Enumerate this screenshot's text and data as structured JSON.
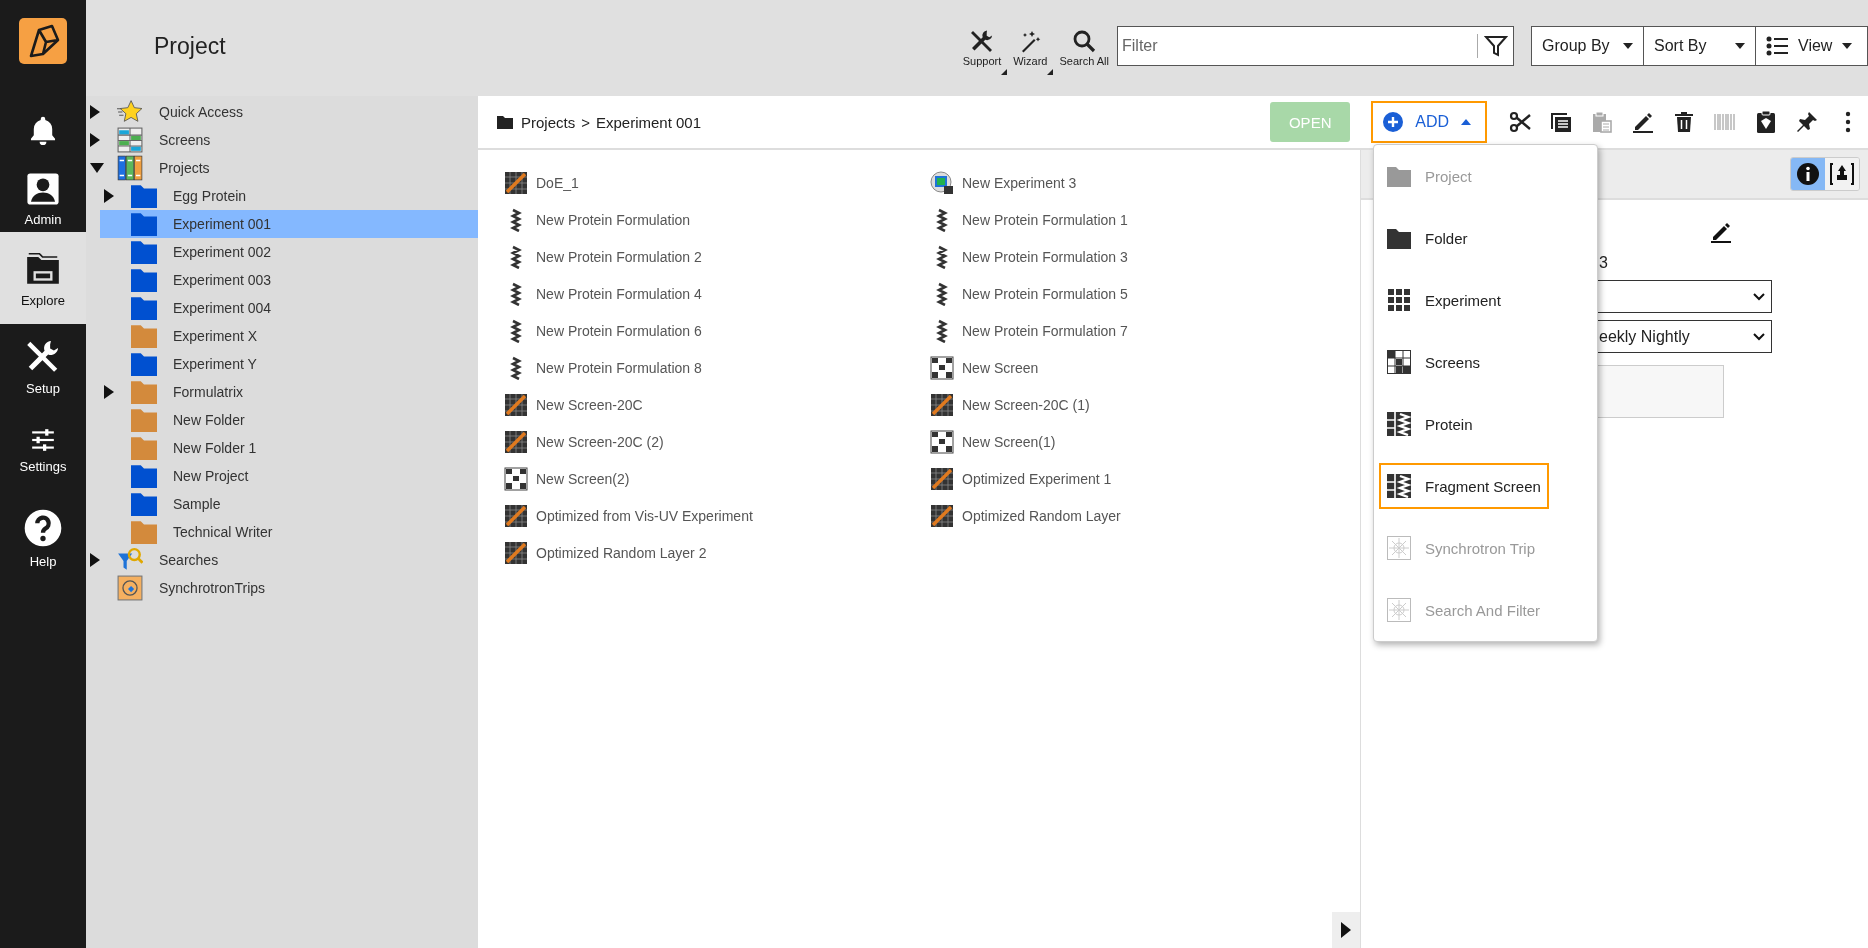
{
  "sidebar": {
    "items": [
      {
        "kind": "bell",
        "selected": false
      },
      {
        "kind": "user",
        "label": "Admin",
        "selected": false
      },
      {
        "kind": "explore",
        "label": "Explore",
        "selected": true
      },
      {
        "kind": "setup",
        "label": "Setup",
        "selected": false
      },
      {
        "kind": "settings",
        "label": "Settings",
        "selected": false
      },
      {
        "kind": "help",
        "label": "Help",
        "selected": false
      }
    ]
  },
  "header": {
    "title": "Project",
    "tools": [
      {
        "kind": "support",
        "label": "Support",
        "has_menu": true
      },
      {
        "kind": "wizard",
        "label": "Wizard",
        "has_menu": true
      },
      {
        "kind": "search",
        "label": "Search All",
        "has_menu": false
      }
    ],
    "filter": {
      "placeholder": "Filter"
    },
    "dropdowns": [
      {
        "kind": "plain",
        "label": "Group By"
      },
      {
        "kind": "plain",
        "label": "Sort By"
      },
      {
        "kind": "view",
        "label": "View"
      }
    ]
  },
  "tree": [
    {
      "label": "Quick Access",
      "kind": "star",
      "expanded": false,
      "selected": false
    },
    {
      "label": "Screens",
      "kind": "screens",
      "expanded": false,
      "selected": false
    },
    {
      "label": "Projects",
      "kind": "binder",
      "expanded": true,
      "selected": false,
      "children": [
        {
          "label": "Egg Protein",
          "kind": "folder",
          "color": "#0050d0",
          "expanded": false,
          "selected": false
        },
        {
          "label": "Experiment 001",
          "kind": "folder",
          "color": "#0050d0",
          "selected": true
        },
        {
          "label": "Experiment 002",
          "kind": "folder",
          "color": "#0050d0",
          "selected": false
        },
        {
          "label": "Experiment 003",
          "kind": "folder",
          "color": "#0050d0",
          "selected": false
        },
        {
          "label": "Experiment 004",
          "kind": "folder",
          "color": "#0050d0",
          "selected": false
        },
        {
          "label": "Experiment X",
          "kind": "folder",
          "color": "#d38a3c",
          "selected": false
        },
        {
          "label": "Experiment Y",
          "kind": "folder",
          "color": "#0050d0",
          "selected": false
        },
        {
          "label": "Formulatrix",
          "kind": "folder",
          "color": "#d38a3c",
          "expanded": false,
          "selected": false
        },
        {
          "label": "New Folder",
          "kind": "folder",
          "color": "#d38a3c",
          "selected": false
        },
        {
          "label": "New Folder 1",
          "kind": "folder",
          "color": "#d38a3c",
          "selected": false
        },
        {
          "label": "New Project",
          "kind": "folder",
          "color": "#0050d0",
          "selected": false
        },
        {
          "label": "Sample",
          "kind": "folder",
          "color": "#0050d0",
          "selected": false
        },
        {
          "label": "Technical Writer",
          "kind": "folder",
          "color": "#d38a3c",
          "selected": false
        }
      ]
    },
    {
      "label": "Searches",
      "kind": "searches",
      "expanded": false,
      "selected": false
    },
    {
      "label": "SynchrotronTrips",
      "kind": "synchrotron",
      "selected": false
    }
  ],
  "breadcrumb": {
    "items": [
      "Projects",
      "Experiment 001"
    ],
    "separator": ">"
  },
  "actions": {
    "open": {
      "label": "OPEN",
      "disabled": true
    },
    "add": {
      "label": "ADD",
      "expanded": true
    },
    "tools": [
      {
        "kind": "cut",
        "disabled": false
      },
      {
        "kind": "copy",
        "disabled": false
      },
      {
        "kind": "paste",
        "disabled": true
      },
      {
        "kind": "edit",
        "disabled": false
      },
      {
        "kind": "delete",
        "disabled": false
      },
      {
        "kind": "barcode",
        "disabled": true
      },
      {
        "kind": "clipboard",
        "disabled": false
      },
      {
        "kind": "pin",
        "disabled": false
      },
      {
        "kind": "more",
        "disabled": false
      }
    ]
  },
  "files": [
    {
      "name": "DoE_1",
      "kind": "optimization"
    },
    {
      "name": "New Experiment 3",
      "kind": "experiment"
    },
    {
      "name": "New Protein Formulation",
      "kind": "protein"
    },
    {
      "name": "New Protein Formulation 1",
      "kind": "protein"
    },
    {
      "name": "New Protein Formulation 2",
      "kind": "protein"
    },
    {
      "name": "New Protein Formulation 3",
      "kind": "protein"
    },
    {
      "name": "New Protein Formulation 4",
      "kind": "protein"
    },
    {
      "name": "New Protein Formulation 5",
      "kind": "protein"
    },
    {
      "name": "New Protein Formulation 6",
      "kind": "protein"
    },
    {
      "name": "New Protein Formulation 7",
      "kind": "protein"
    },
    {
      "name": "New Protein Formulation 8",
      "kind": "protein"
    },
    {
      "name": "New Screen",
      "kind": "screen"
    },
    {
      "name": "New Screen-20C",
      "kind": "optimization"
    },
    {
      "name": "New Screen-20C (1)",
      "kind": "optimization"
    },
    {
      "name": "New Screen-20C (2)",
      "kind": "optimization"
    },
    {
      "name": "New Screen(1)",
      "kind": "screen"
    },
    {
      "name": "New Screen(2)",
      "kind": "screen"
    },
    {
      "name": "Optimized Experiment 1",
      "kind": "optimization"
    },
    {
      "name": "Optimized from Vis-UV Experiment",
      "kind": "optimization"
    },
    {
      "name": "Optimized Random Layer",
      "kind": "optimization"
    },
    {
      "name": "Optimized Random Layer 2",
      "kind": "optimization"
    }
  ],
  "add_menu": [
    {
      "label": "Project",
      "kind": "project",
      "disabled": true,
      "selected": false
    },
    {
      "label": "Folder",
      "kind": "folder",
      "disabled": false,
      "selected": false
    },
    {
      "label": "Experiment",
      "kind": "experiment",
      "disabled": false,
      "selected": false
    },
    {
      "label": "Screens",
      "kind": "screens",
      "disabled": false,
      "selected": false
    },
    {
      "label": "Protein",
      "kind": "protein",
      "disabled": false,
      "selected": false
    },
    {
      "label": "Fragment Screen",
      "kind": "fragment",
      "disabled": false,
      "selected": true
    },
    {
      "label": "Synchrotron Trip",
      "kind": "synchrotron",
      "disabled": true,
      "selected": false
    },
    {
      "label": "Search And Filter",
      "kind": "search",
      "disabled": true,
      "selected": false
    }
  ],
  "details": {
    "toggles": [
      {
        "kind": "info",
        "selected": true
      },
      {
        "kind": "structure",
        "selected": false
      }
    ],
    "label": "3",
    "fields": [
      {
        "kind": "select"
      },
      {
        "kind": "select",
        "value": "eekly Nightly"
      },
      {
        "kind": "textarea"
      }
    ]
  }
}
